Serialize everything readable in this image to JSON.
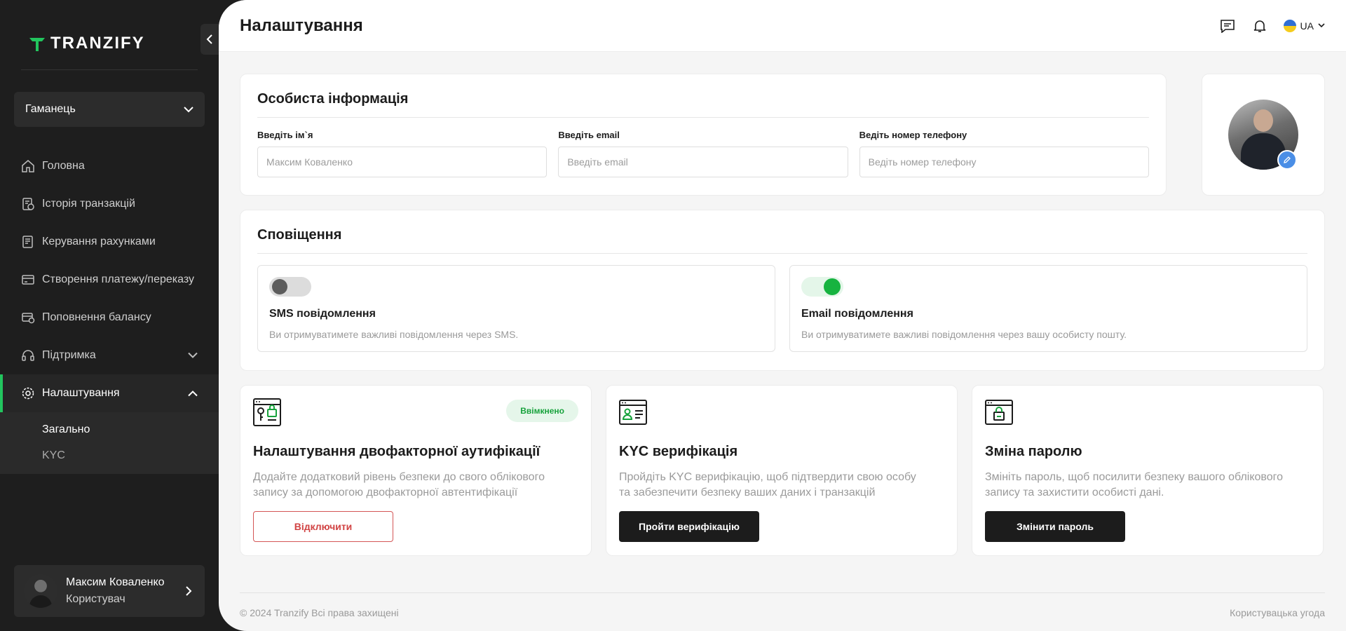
{
  "brand": {
    "name": "TRANZIFY",
    "accent": "#22c55e"
  },
  "sidebar": {
    "wallet": "Гаманець",
    "items": [
      {
        "label": "Головна",
        "icon": "home-icon"
      },
      {
        "label": "Історія транзакцій",
        "icon": "history-icon"
      },
      {
        "label": "Керування рахунками",
        "icon": "accounts-icon"
      },
      {
        "label": "Створення платежу/переказу",
        "icon": "payment-icon"
      },
      {
        "label": "Поповнення балансу",
        "icon": "topup-icon"
      },
      {
        "label": "Підтримка",
        "icon": "headset-icon"
      },
      {
        "label": "Налаштування",
        "icon": "gear-icon"
      }
    ],
    "submenu": [
      "Загально",
      "KYC"
    ],
    "user": {
      "name": "Максим Коваленко",
      "role": "Користувач"
    }
  },
  "header": {
    "title": "Налаштування",
    "lang": "UA"
  },
  "personal": {
    "title": "Особиста інформація",
    "name_label": "Введіть ім`я",
    "name_placeholder": "Максим Коваленко",
    "email_label": "Введіть email",
    "email_placeholder": "Введіть email",
    "phone_label": "Ведіть номер телефону",
    "phone_placeholder": "Ведіть номер телефону"
  },
  "notifications": {
    "title": "Сповіщення",
    "sms": {
      "title": "SMS повідомлення",
      "desc": "Ви отримуватимете важливі повідомлення через SMS.",
      "enabled": false
    },
    "email": {
      "title": "Email повідомлення",
      "desc": "Ви отримуватимете важливі повідомлення через вашу особисту пошту.",
      "enabled": true
    }
  },
  "features": {
    "twofa": {
      "badge": "Ввімкнено",
      "title": "Налаштування двофакторної аутифікації",
      "desc": "Додайте додатковий рівень безпеки до свого облікового запису за допомогою двофакторної автентифікації",
      "button": "Відключити"
    },
    "kyc": {
      "title": "KYC верифікація",
      "desc": "Пройдіть KYC верифікацію, щоб підтвердити свою особу та забезпечити безпеку ваших даних і транзакцій",
      "button": "Пройти верифікацію"
    },
    "password": {
      "title": "Зміна паролю",
      "desc": "Змініть пароль, щоб посилити безпеку вашого облікового запису та захистити особисті дані.",
      "button": "Змінити пароль"
    }
  },
  "footer": {
    "copyright": "© 2024 Tranzify Всі права захищені",
    "agreement": "Користувацька угода"
  }
}
